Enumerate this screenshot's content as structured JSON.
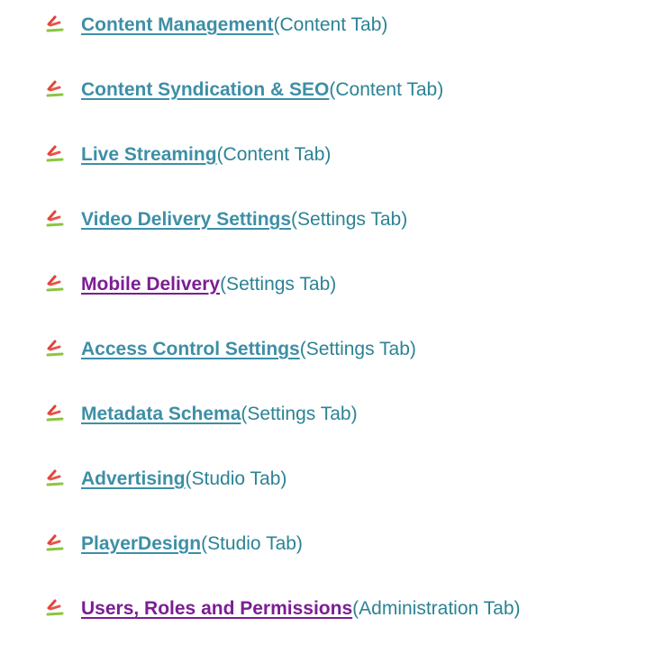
{
  "colors": {
    "link": "#3d8fa6",
    "visited_link": "#7b1e93",
    "note": "#2b8394",
    "bullet_top": "#e2443a",
    "bullet_bottom": "#8bc53f"
  },
  "icons": {
    "bullet": "checkmark-bullet-icon"
  },
  "items": [
    {
      "link": "Content Management",
      "note": " (Content Tab)",
      "visited": false
    },
    {
      "link": "Content Syndication & SEO",
      "note": "(Content Tab)",
      "visited": false
    },
    {
      "link": "Live Streaming",
      "note": "(Content Tab)",
      "visited": false
    },
    {
      "link": "Video Delivery Settings",
      "note": " (Settings Tab)",
      "visited": false
    },
    {
      "link": "Mobile Delivery",
      "note": "(Settings Tab)",
      "visited": true
    },
    {
      "link": "Access Control Settings",
      "note": " (Settings Tab)",
      "visited": false
    },
    {
      "link": "Metadata Schema",
      "note": " (Settings Tab)",
      "visited": false
    },
    {
      "link": "Advertising",
      "note": " (Studio Tab)",
      "visited": false
    },
    {
      "link": "PlayerDesign",
      "note": " (Studio Tab)",
      "visited": false
    },
    {
      "link": "Users, Roles  and Permissions",
      "note": "(Administration Tab)",
      "visited": true
    }
  ]
}
